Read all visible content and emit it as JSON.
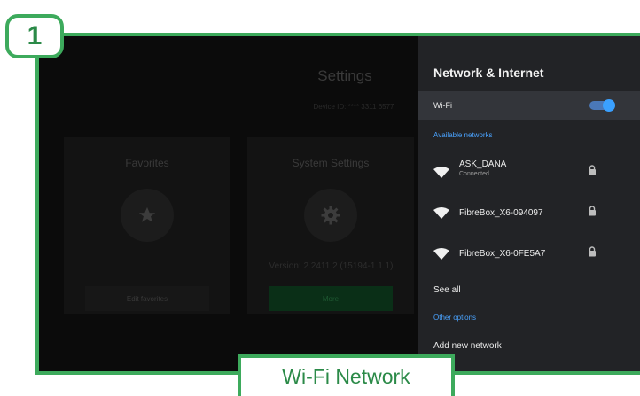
{
  "step_number": "1",
  "caption": "Wi-Fi Network",
  "colors": {
    "frame_green": "#3daa5c",
    "panel_bg": "#222326",
    "accent_blue": "#4aa3ff",
    "toggle_on": "#3aa0ff"
  },
  "settings": {
    "title": "Settings",
    "device_id": "Device ID: **** 3311 6577",
    "tiles": [
      {
        "title": "Favorites",
        "icon": "star-icon",
        "button": "Edit favorites"
      },
      {
        "title": "System Settings",
        "icon": "gear-icon",
        "version": "Version: 2.2411.2 (15194-1.1.1)",
        "button": "More"
      }
    ]
  },
  "network_panel": {
    "title": "Network & Internet",
    "wifi_label": "Wi-Fi",
    "wifi_enabled": true,
    "available_label": "Available networks",
    "networks": [
      {
        "name": "ASK_DANA",
        "status": "Connected",
        "icon": "wifi-icon",
        "secured": true
      },
      {
        "name": "FibreBox_X6-094097",
        "status": "",
        "icon": "wifi-icon",
        "secured": true
      },
      {
        "name": "FibreBox_X6-0FE5A7",
        "status": "",
        "icon": "wifi-icon",
        "secured": true
      }
    ],
    "see_all": "See all",
    "other_options_label": "Other options",
    "add_network": "Add new network"
  }
}
